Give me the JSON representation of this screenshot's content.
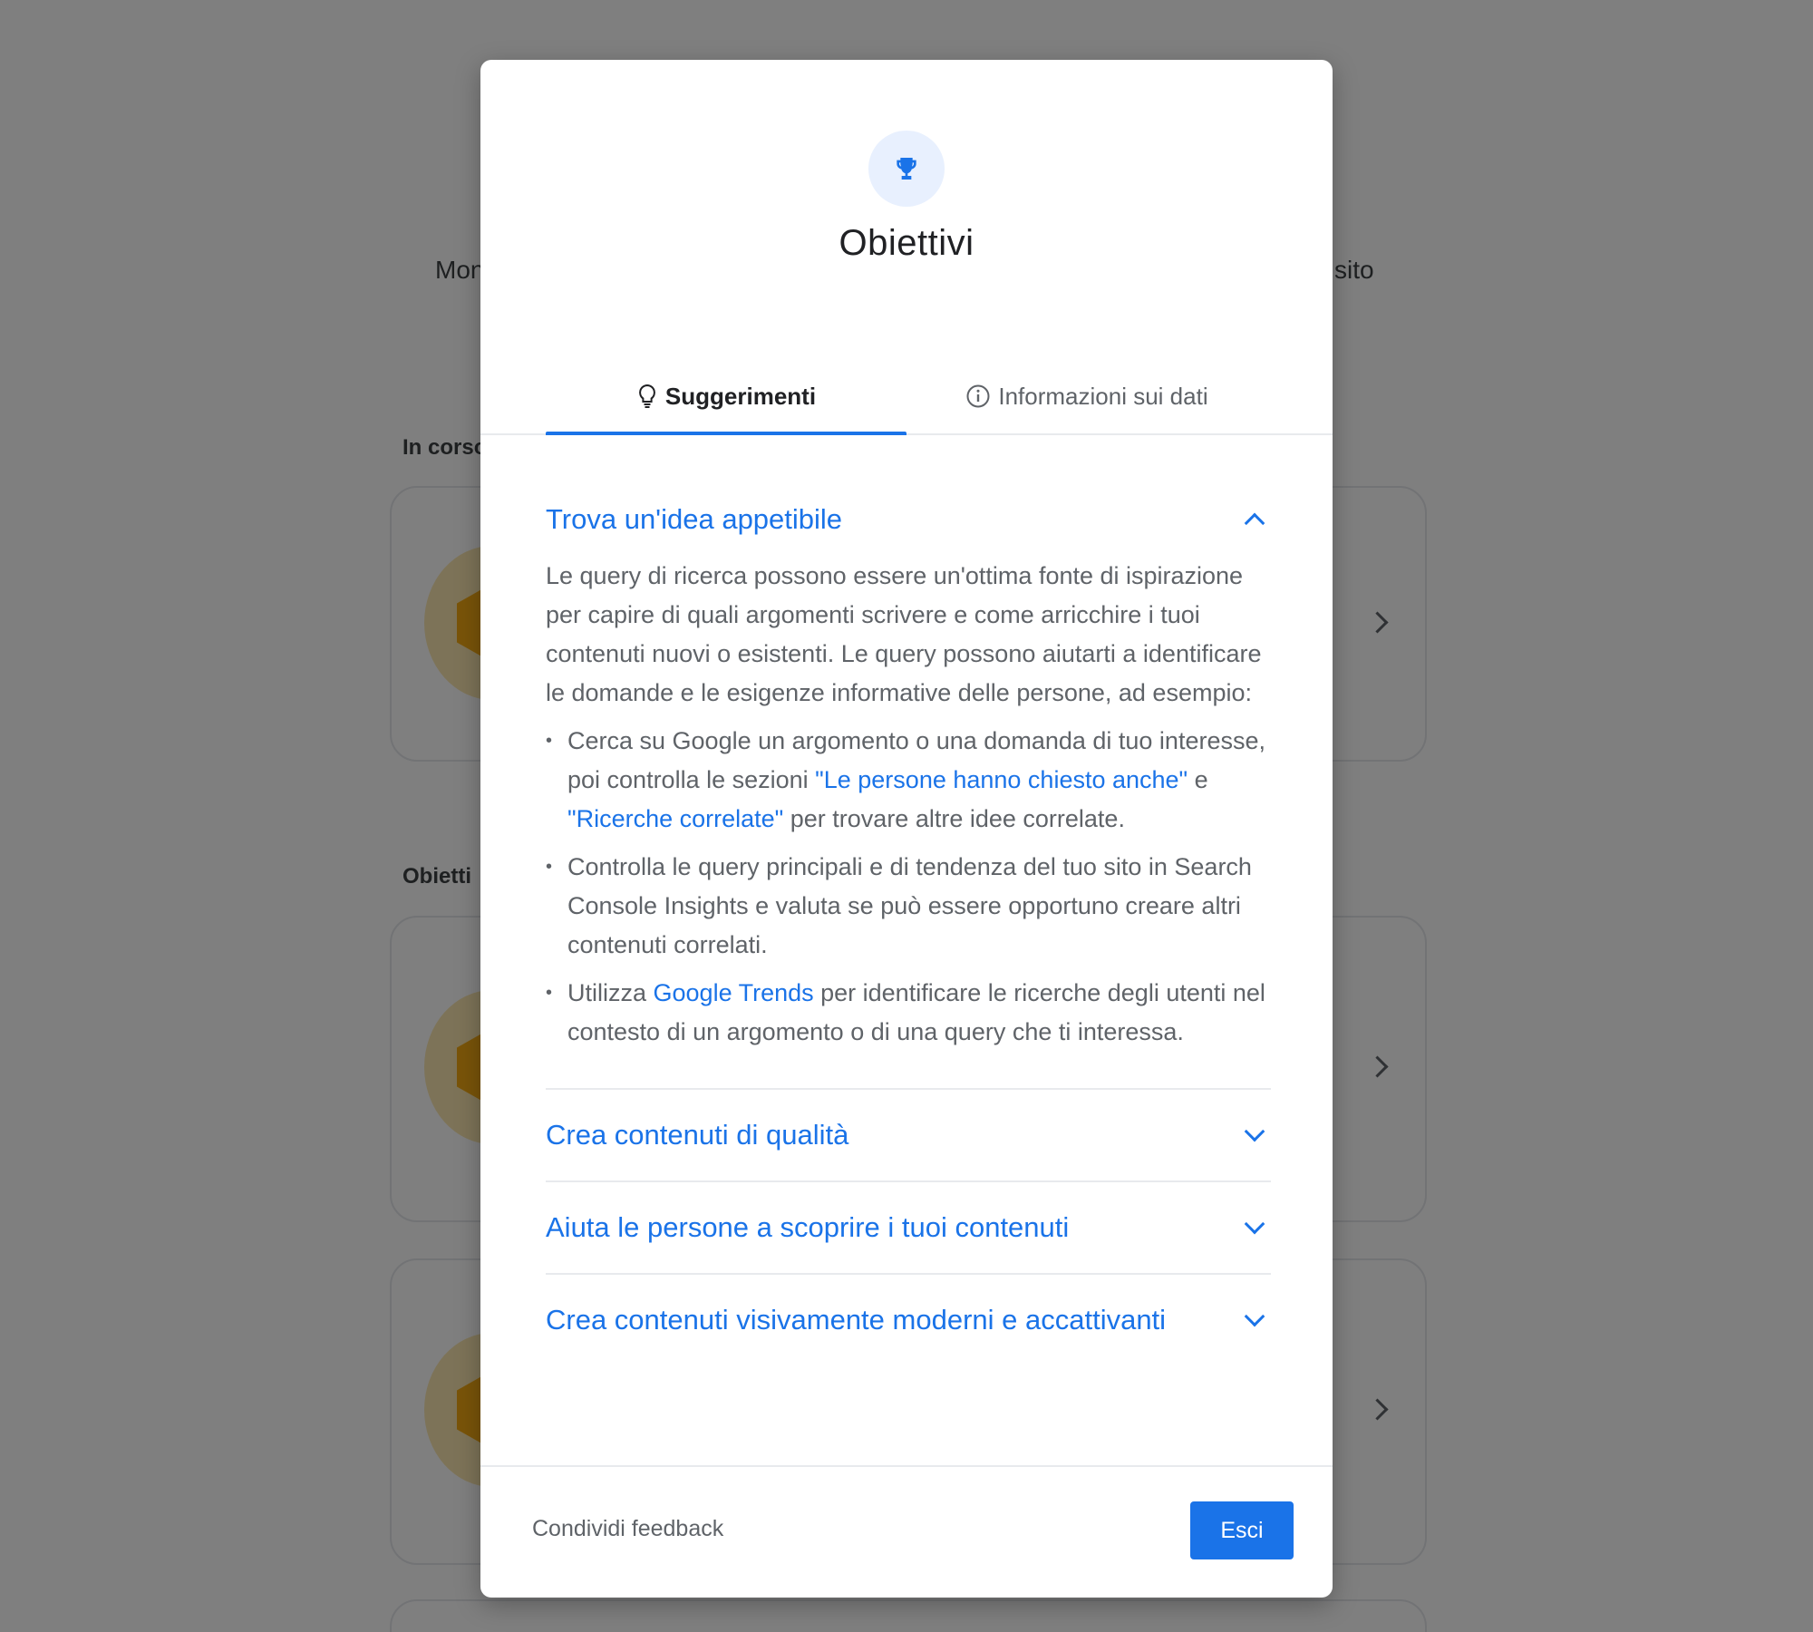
{
  "background": {
    "left_text_top": "Mon",
    "right_text_top": "sito",
    "section_in_progress": "In corso",
    "section_goals": "Obietti"
  },
  "dialog": {
    "icon": "trophy-icon",
    "title": "Obiettivi",
    "tabs": [
      {
        "label": "Suggerimenti",
        "icon": "lightbulb-icon",
        "active": true
      },
      {
        "label": "Informazioni sui dati",
        "icon": "info-icon",
        "active": false
      }
    ],
    "accordion": [
      {
        "title": "Trova un'idea appetibile",
        "expanded": true,
        "intro": "Le query di ricerca possono essere un'ottima fonte di ispirazione per capire di quali argomenti scrivere e come arricchire i tuoi contenuti nuovi o esistenti. Le query possono aiutarti a identificare le domande e le esigenze informative delle persone, ad esempio:",
        "bullets": [
          {
            "text_1": "Cerca su Google un argomento o una domanda di tuo interesse, poi controlla le sezioni ",
            "link_1": "\"Le persone hanno chiesto anche\"",
            "text_2": " e ",
            "link_2": "\"Ricerche correlate\"",
            "text_3": " per trovare altre idee correlate."
          },
          {
            "text": "Controlla le query principali e di tendenza del tuo sito in Search Console Insights e valuta se può essere opportuno creare altri contenuti correlati."
          },
          {
            "text_1": "Utilizza ",
            "link": "Google Trends",
            "text_2": " per identificare le ricerche degli utenti nel contesto di un argomento o di una query che ti interessa."
          }
        ]
      },
      {
        "title": "Crea contenuti di qualità",
        "expanded": false
      },
      {
        "title": "Aiuta le persone a scoprire i tuoi contenuti",
        "expanded": false
      },
      {
        "title": "Crea contenuti visivamente moderni e accattivanti",
        "expanded": false
      }
    ],
    "footer": {
      "feedback_label": "Condividi feedback",
      "exit_label": "Esci"
    }
  },
  "colors": {
    "accent": "#1a73e8",
    "scrim": "rgba(0,0,0,0.5)",
    "badge_gold": "#f3a912"
  }
}
